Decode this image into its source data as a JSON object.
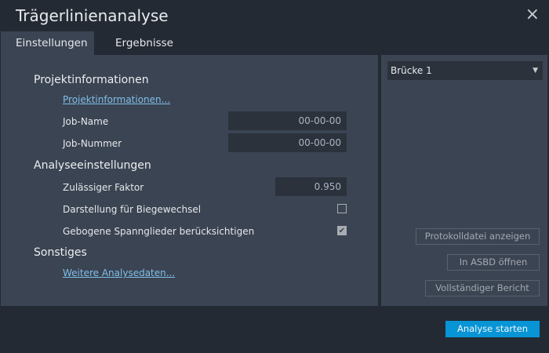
{
  "window": {
    "title": "Trägerlinienanalyse",
    "close_icon": "×"
  },
  "tabs": [
    {
      "label": "Einstellungen",
      "active": true
    },
    {
      "label": "Ergebnisse",
      "active": false
    }
  ],
  "settings": {
    "project_section": "Projektinformationen",
    "project_link": "Projektinformationen...",
    "job_name_label": "Job-Name",
    "job_name_value": "00-00-00",
    "job_number_label": "Job-Nummer",
    "job_number_value": "00-00-00",
    "analysis_section": "Analyseeinstellungen",
    "factor_label": "Zulässiger Faktor",
    "factor_value": "0.950",
    "bending_label": "Darstellung für Biegewechsel",
    "bending_checked": false,
    "tendons_label": "Gebogene Spannglieder berücksichtigen",
    "tendons_checked": true,
    "check_glyph": "✔",
    "other_section": "Sonstiges",
    "more_link": "Weitere Analysedaten..."
  },
  "right": {
    "bridge_select": "Brücke 1",
    "dropdown_glyph": "▼",
    "log_button": "Protokolldatei anzeigen",
    "asbd_button": "In ASBD öffnen",
    "report_button": "Vollständiger Bericht"
  },
  "footer": {
    "start_button": "Analyse starten"
  }
}
